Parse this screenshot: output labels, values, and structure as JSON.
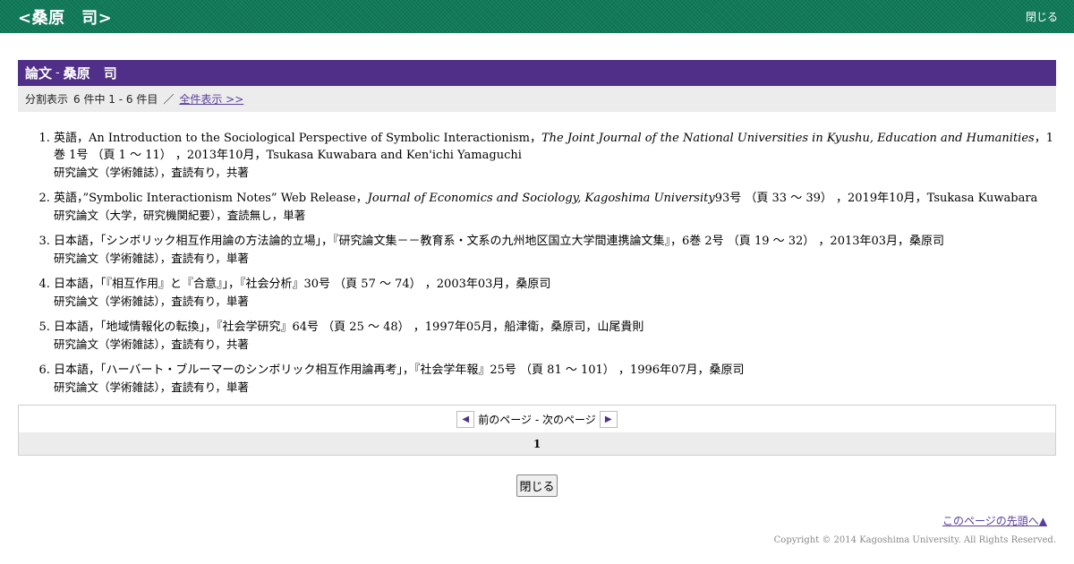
{
  "header": {
    "title": "<桑原　司>",
    "close_label": "閉じる"
  },
  "section": {
    "heading_main": "論文",
    "heading_sep": "-",
    "heading_name": "桑原　司",
    "display_label": "分割表示",
    "count_text": "6 件中 1 - 6 件目",
    "slash": "／",
    "show_all_label": "全件表示 >>"
  },
  "papers": [
    {
      "pre": "英語，An Introduction to the Sociological Perspective of Symbolic Interactionism，",
      "journal": "The Joint Journal of the National Universities in Kyushu, Education and Humanities",
      "post": "，1巻 1号 （頁 1 ～ 11） ，2013年10月，Tsukasa Kuwabara and Ken'ichi Yamaguchi",
      "type": "研究論文（学術雑誌），査読有り，共著"
    },
    {
      "pre": "英語，”Symbolic Interactionism Notes” Web Release，",
      "journal": "Journal of Economics and Sociology, Kagoshima University",
      "post": "93号 （頁 33 ～ 39） ，2019年10月，Tsukasa Kuwabara",
      "type": "研究論文（大学，研究機関紀要），査読無し，単著"
    },
    {
      "pre": "日本語，「シンボリック相互作用論の方法論的立場」，『研究論文集－－教育系・文系の九州地区国立大学間連携論文集』，6巻 2号 （頁 19 ～ 32） ，2013年03月，桑原司",
      "journal": "",
      "post": "",
      "type": "研究論文（学術雑誌），査読有り，単著"
    },
    {
      "pre": "日本語，「『相互作用』と『合意』」，『社会分析』30号 （頁 57 ～ 74） ，2003年03月，桑原司",
      "journal": "",
      "post": "",
      "type": "研究論文（学術雑誌），査読有り，単著"
    },
    {
      "pre": "日本語，「地域情報化の転換」，『社会学研究』64号 （頁 25 ～ 48） ，1997年05月，船津衛，桑原司，山尾貴則",
      "journal": "",
      "post": "",
      "type": "研究論文（学術雑誌），査読有り，共著"
    },
    {
      "pre": "日本語，「ハーバート・ブルーマーのシンボリック相互作用論再考」，『社会学年報』25号 （頁 81 ～ 101） ，1996年07月，桑原司",
      "journal": "",
      "post": "",
      "type": "研究論文（学術雑誌），査読有り，単著"
    }
  ],
  "pager": {
    "prev_icon": "triangle-left-icon",
    "next_icon": "triangle-right-icon",
    "label": "前のページ - 次のページ",
    "current_page": "1"
  },
  "footer": {
    "close_button": "閉じる",
    "top_link": "このページの先頭へ▲",
    "copyright": "Copyright © 2014 Kagoshima University. All Rights Reserved."
  },
  "colors": {
    "topbar": "#0f7a57",
    "section_header": "#4f2f87",
    "link": "#5b3fa0"
  }
}
